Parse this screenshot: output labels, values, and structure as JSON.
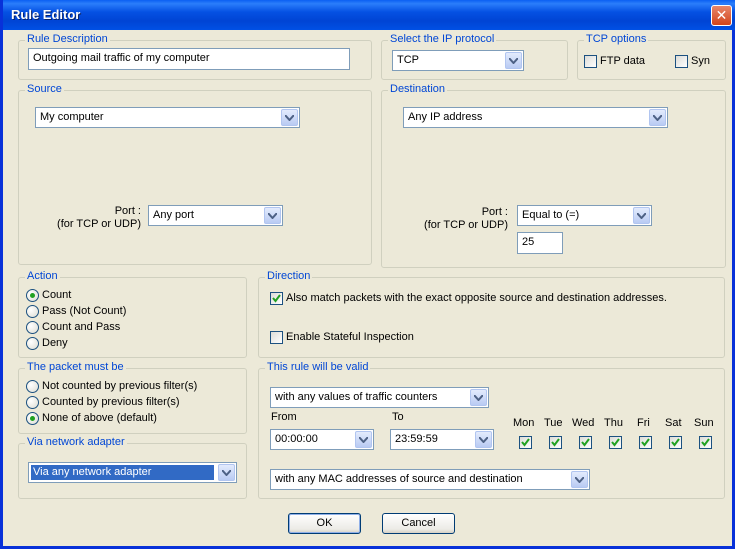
{
  "window": {
    "title": "Rule Editor",
    "close_icon": "close-icon"
  },
  "rule_description": {
    "title": "Rule Description",
    "value": "Outgoing mail traffic of my computer"
  },
  "ip_protocol": {
    "title": "Select the IP protocol",
    "value": "TCP"
  },
  "tcp_options": {
    "title": "TCP options",
    "ftp_data": "FTP data",
    "syn": "Syn",
    "ftp_checked": false,
    "syn_checked": false
  },
  "source": {
    "title": "Source",
    "address": "My computer",
    "port_label_1": "Port :",
    "port_label_2": "(for TCP or UDP)",
    "port": "Any port"
  },
  "destination": {
    "title": "Destination",
    "address": "Any IP address",
    "port_label_1": "Port :",
    "port_label_2": "(for TCP or UDP)",
    "port_op": "Equal to (=)",
    "port_value": "25"
  },
  "action": {
    "title": "Action",
    "options": [
      "Count",
      "Pass (Not Count)",
      "Count and Pass",
      "Deny"
    ],
    "selected": 0
  },
  "direction": {
    "title": "Direction",
    "opposite": "Also match packets with the exact opposite source and destination addresses.",
    "opposite_checked": true,
    "stateful": "Enable Stateful Inspection",
    "stateful_checked": false
  },
  "packet": {
    "title": "The packet must be",
    "options": [
      "Not counted by previous filter(s)",
      "Counted by previous filter(s)",
      "None of above (default)"
    ],
    "selected": 2
  },
  "validity": {
    "title": "This rule will be valid",
    "counters": "with any values of traffic counters",
    "from_label": "From",
    "to_label": "To",
    "from": "00:00:00",
    "to": "23:59:59",
    "days": [
      "Mon",
      "Tue",
      "Wed",
      "Thu",
      "Fri",
      "Sat",
      "Sun"
    ],
    "mac": "with any MAC addresses of source and destination"
  },
  "adapter": {
    "title": "Via network adapter",
    "value": "Via any network adapter"
  },
  "buttons": {
    "ok": "OK",
    "cancel": "Cancel"
  },
  "colors": {
    "group_title": "#0046d5",
    "face": "#ece9d8",
    "titlebar": "#0551e3",
    "selection": "#316ac5"
  }
}
